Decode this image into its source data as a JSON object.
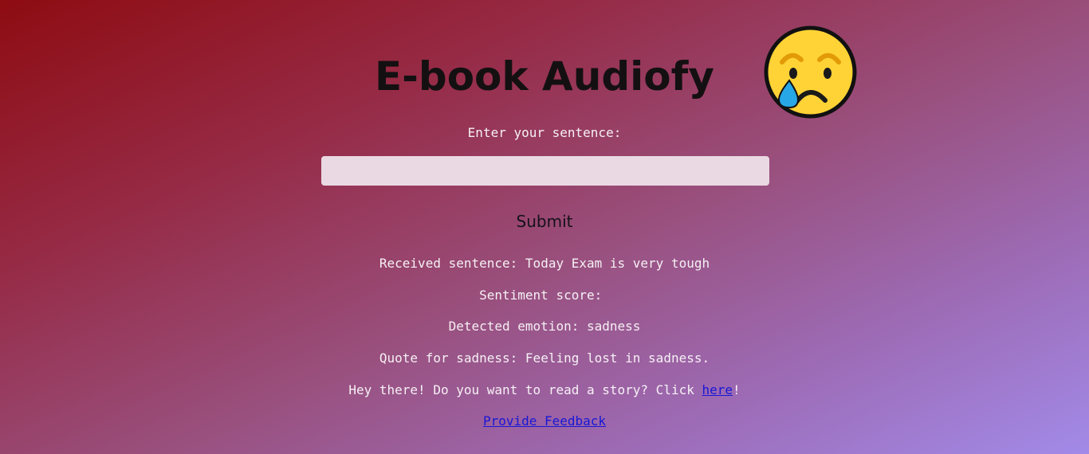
{
  "header": {
    "title": "E-book Audiofy",
    "emotion_emoji": "crying-face-icon"
  },
  "form": {
    "label": "Enter your sentence:",
    "input_value": "",
    "submit_label": "Submit"
  },
  "result": {
    "received_label": "Received sentence:",
    "received_value": "Today Exam is very tough",
    "score_label": "Sentiment score:",
    "score_value": "",
    "emotion_label": "Detected emotion:",
    "emotion_value": "sadness",
    "quote_label": "Quote for sadness:",
    "quote_value": "Feeling lost in sadness.",
    "story_prefix": "Hey there! Do you want to read a story? Click ",
    "story_link": "here",
    "story_suffix": "!",
    "feedback_link": "Provide Feedback"
  },
  "colors": {
    "gradient_start": "#8e0c12",
    "gradient_end": "#a28ae8",
    "link": "#1717d6",
    "input_bg": "#ead9e3",
    "title_text": "#141012"
  }
}
